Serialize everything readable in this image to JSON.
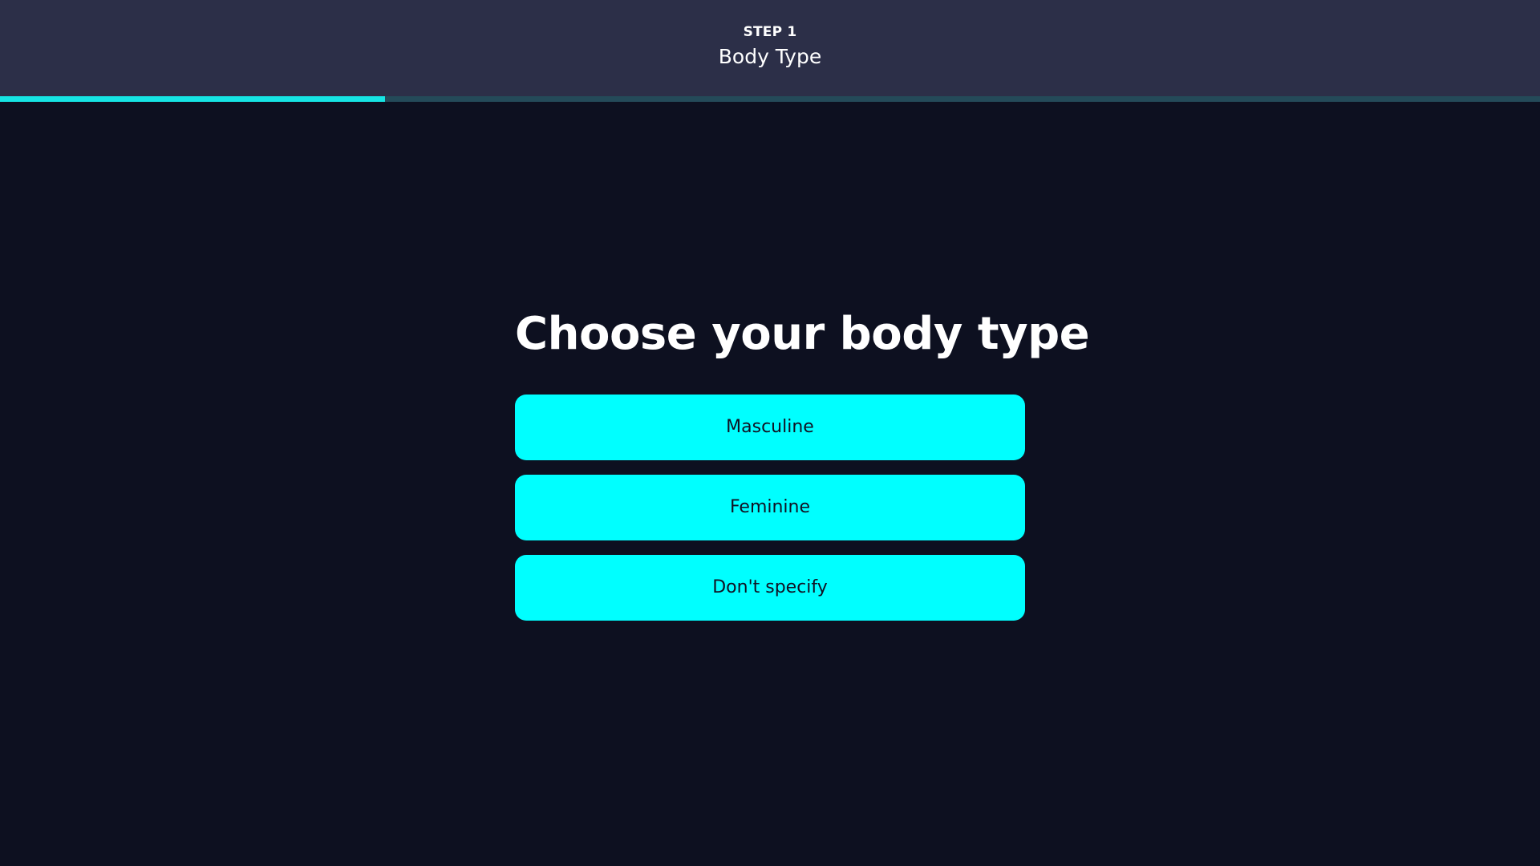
{
  "header": {
    "step_label": "STEP 1",
    "step_title": "Body Type"
  },
  "progress": {
    "fraction": 0.25,
    "fill_color": "#16e4e4",
    "track_color": "#244a59"
  },
  "main": {
    "question": "Choose your body type",
    "options": [
      {
        "label": "Masculine"
      },
      {
        "label": "Feminine"
      },
      {
        "label": "Don't specify"
      }
    ]
  },
  "colors": {
    "background": "#0d1020",
    "header_bg": "#2c2f48",
    "button_bg": "#00ffff",
    "button_text": "#111122"
  }
}
